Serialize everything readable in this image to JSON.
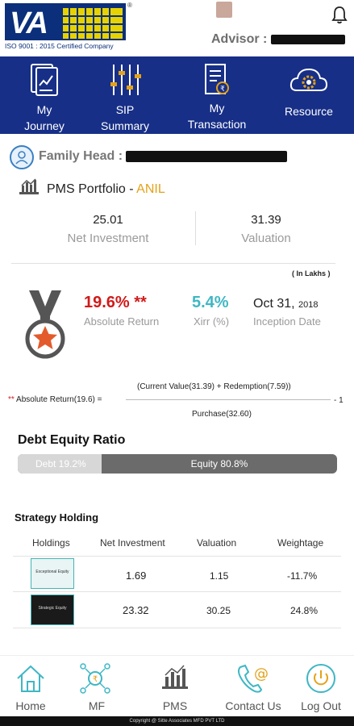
{
  "header": {
    "logo_text": "VA",
    "logo_iso": "ISO 9001 : 2015 Certified Company",
    "logo_reg": "®",
    "advisor_label": "Advisor :"
  },
  "nav": {
    "items": [
      {
        "label_1": "My",
        "label_2": "Journey",
        "icon": "journey-icon"
      },
      {
        "label_1": "SIP",
        "label_2": "Summary",
        "icon": "sliders-icon"
      },
      {
        "label_1": "My",
        "label_2": "Transaction",
        "icon": "transaction-icon"
      },
      {
        "label_1": "Resource",
        "label_2": "",
        "icon": "cloud-gear-icon"
      }
    ]
  },
  "family": {
    "label": "Family Head :"
  },
  "portfolio": {
    "title": "PMS Portfolio",
    "separator": " - ",
    "name": "ANIL",
    "net_investment_value": "25.01",
    "net_investment_label": "Net Investment",
    "valuation_value": "31.39",
    "valuation_label": "Valuation",
    "unit_note": "( In Lakhs )"
  },
  "returns": {
    "absolute_value": "19.6% **",
    "absolute_label": "Absolute Return",
    "xirr_value": "5.4%",
    "xirr_label": "Xirr (%)",
    "inception_date": "Oct 31,",
    "inception_year": "2018",
    "inception_label": "Inception Date",
    "colors": {
      "absolute": "#d11a1a",
      "xirr": "#3fb7c4",
      "medal_star": "#e35b2c"
    }
  },
  "formula": {
    "stars": "**",
    "left": " Absolute Return(19.6) =",
    "numerator": "(Current Value(31.39) + Redemption(7.59))",
    "denominator": "Purchase(32.60)",
    "minus": "- 1"
  },
  "debt_equity": {
    "title": "Debt Equity Ratio",
    "debt_label": "Debt 19.2%",
    "equity_label": "Equity 80.8%",
    "debt_fraction": 0.262,
    "equity_fraction": 0.738
  },
  "strategy": {
    "title": "Strategy Holding",
    "columns": [
      "Holdings",
      "Net Investment",
      "Valuation",
      "Weightage"
    ],
    "rows": [
      {
        "thumb": "Exceptional Equity",
        "net_investment": "1.69",
        "valuation": "1.15",
        "weightage": "-11.7%"
      },
      {
        "thumb": "Strategic Equity",
        "net_investment": "23.32",
        "valuation": "30.25",
        "weightage": "24.8%"
      }
    ]
  },
  "bottom_nav": {
    "items": [
      {
        "label": "Home",
        "icon": "home-icon"
      },
      {
        "label": "MF",
        "icon": "mf-network-icon"
      },
      {
        "label": "PMS",
        "icon": "pms-chart-icon"
      },
      {
        "label": "Contact Us",
        "icon": "contact-icon"
      },
      {
        "label": "Log Out",
        "icon": "power-icon"
      }
    ]
  },
  "footer": {
    "text": "Copyright @ Sitte Associates MFD PVT LTD"
  }
}
